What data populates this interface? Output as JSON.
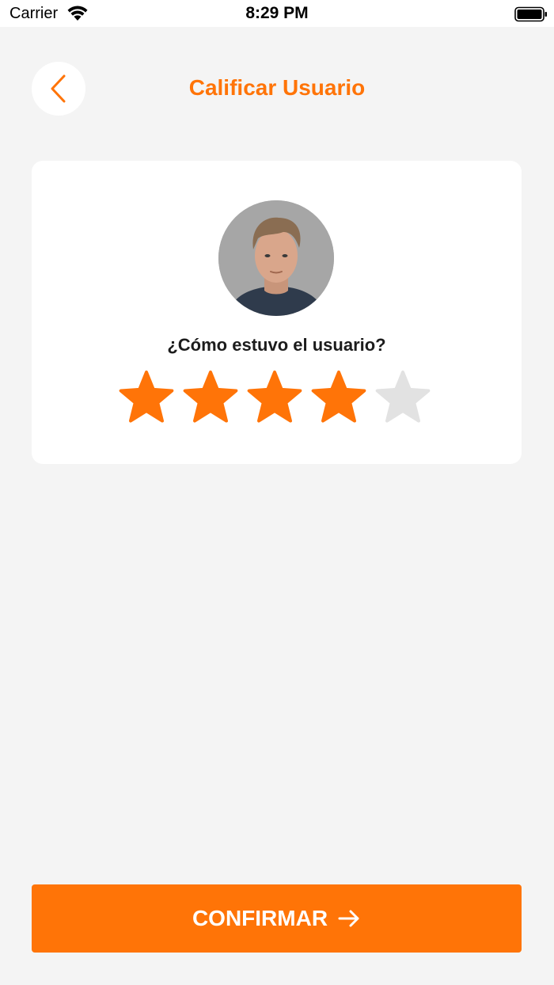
{
  "status_bar": {
    "carrier": "Carrier",
    "time": "8:29 PM",
    "wifi_icon": "wifi-icon",
    "battery_icon": "battery-icon"
  },
  "header": {
    "title": "Calificar Usuario",
    "back_icon": "chevron-left-icon"
  },
  "card": {
    "avatar_icon": "user-avatar",
    "question": "¿Cómo estuvo el usuario?",
    "rating": {
      "value": 4,
      "max": 5
    }
  },
  "confirm": {
    "label": "CONFIRMAR",
    "icon": "arrow-right-icon"
  },
  "colors": {
    "accent": "#ff7408",
    "star_empty": "#e2e2e2",
    "background": "#f4f4f4",
    "card": "#ffffff"
  }
}
